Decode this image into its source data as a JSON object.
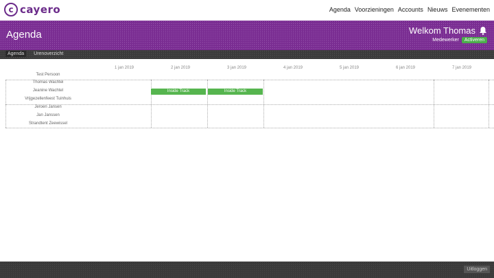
{
  "app": {
    "logo_letter": "c",
    "logo_text": "cayero"
  },
  "nav": {
    "items": [
      "Agenda",
      "Voorzieningen",
      "Accounts",
      "Nieuws",
      "Evenementen"
    ]
  },
  "header": {
    "title": "Agenda",
    "welcome": "Welkom Thomas",
    "mode_label": "Medewerker",
    "mode_button": "Activeren"
  },
  "subbar": {
    "tabs": [
      "Agenda",
      "Urenoverzicht"
    ]
  },
  "agenda": {
    "days": [
      "1 jan 2019",
      "2 jan 2019",
      "3 jan 2019",
      "4 jan 2019",
      "5 jan 2019",
      "6 jan 2019",
      "7 jan 2019"
    ],
    "people": [
      "Test Persoon",
      "Thomas Wachtel",
      "Jeanine Wachtel",
      "Vrijgezellenfeest Tuinhuis",
      "Jeroen Jansen",
      "Jan Janssen",
      "Strandtent Zeewissel"
    ],
    "events": [
      {
        "label": "Inside Track",
        "row": 2,
        "day": 1
      },
      {
        "label": "Inside Track",
        "row": 2,
        "day": 2
      }
    ]
  },
  "footer": {
    "button": "Uitloggen"
  },
  "colors": {
    "brand_purple": "#7a2d92",
    "accent_green": "#4cae4c",
    "dark_bar": "#3b3b3b"
  }
}
